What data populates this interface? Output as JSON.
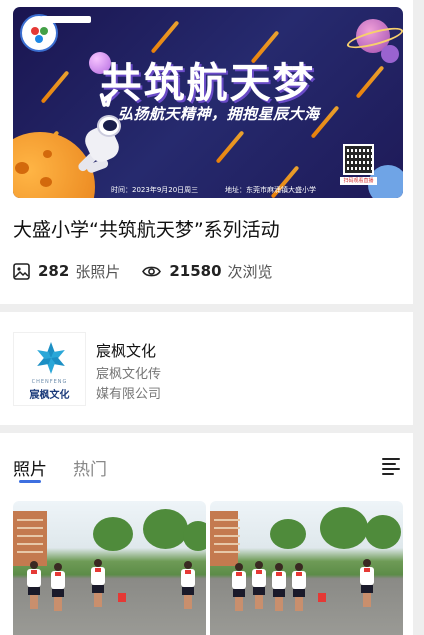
{
  "event": {
    "banner": {
      "title": "共筑航天梦",
      "subtitle": "弘扬航天精神，拥抱星辰大海",
      "time": "时间：2023年9月20日周三",
      "address": "地址：东莞市麻涌镇大盛小学",
      "qr_label": "扫码观看直播"
    },
    "title": "大盛小学“共筑航天梦”系列活动",
    "photo_count": "282",
    "photo_unit": "张照片",
    "view_count": "21580",
    "view_unit": "次浏览"
  },
  "organizer": {
    "logo_en": "CHENFENG",
    "logo_cn": "宸枫文化",
    "name": "宸枫文化",
    "description": "宸枫文化传媒有限公司"
  },
  "gallery": {
    "tabs": [
      {
        "label": "照片",
        "active": true
      },
      {
        "label": "热门",
        "active": false
      }
    ]
  },
  "colors": {
    "accent": "#3d6fe0",
    "banner_bg": "#1e1a58",
    "banner_stripe": "#ffa31a"
  },
  "icons": {
    "photo": "image-icon",
    "views": "eye-icon",
    "menu": "list-menu-icon"
  }
}
